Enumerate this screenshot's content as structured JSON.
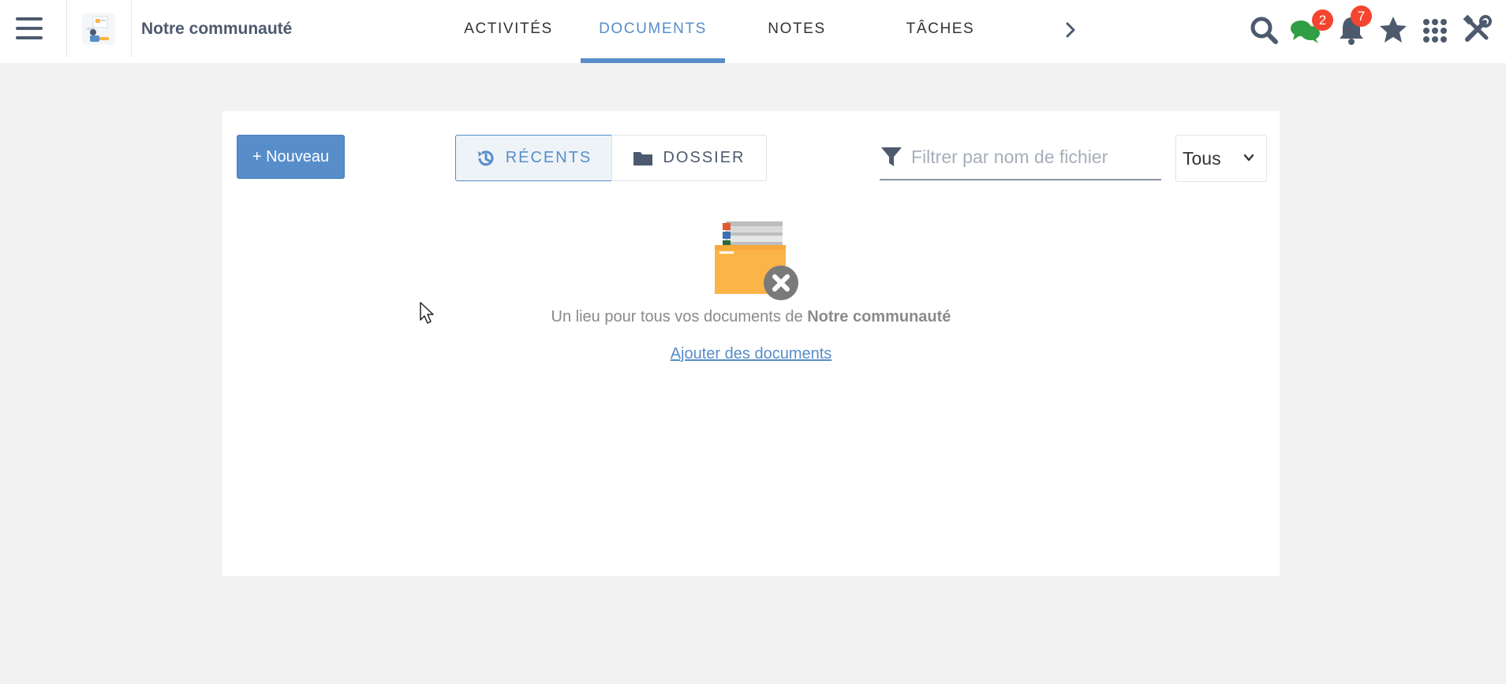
{
  "header": {
    "space_name": "Notre communauté",
    "tabs": [
      {
        "label": "ACTIVITÉS",
        "active": false
      },
      {
        "label": "DOCUMENTS",
        "active": true
      },
      {
        "label": "NOTES",
        "active": false
      },
      {
        "label": "TÂCHES",
        "active": false
      }
    ],
    "icons": {
      "menu": "hamburger-menu-icon",
      "more_tabs": "chevron-right-icon",
      "search": "search-icon",
      "chat": "chat-icon",
      "notifications": "bell-icon",
      "favorites": "star-icon",
      "apps": "grid-icon",
      "admin": "tools-icon"
    },
    "chat_badge": "2",
    "notification_badge": "7"
  },
  "toolbar": {
    "new_button": "+ Nouveau",
    "recent_label": "RÉCENTS",
    "folder_label": "DOSSIER",
    "filter_placeholder": "Filtrer par nom de fichier",
    "filter_value": "",
    "select_value": "Tous"
  },
  "empty_state": {
    "text_prefix": "Un lieu pour tous vos documents de ",
    "text_bold": "Notre communauté",
    "add_link": "Ajouter des documents"
  },
  "colors": {
    "accent": "#578dc9",
    "badge": "#f5452f",
    "chat": "#2f9e44",
    "folder": "#fbb448",
    "icon": "#4d5a6e"
  }
}
